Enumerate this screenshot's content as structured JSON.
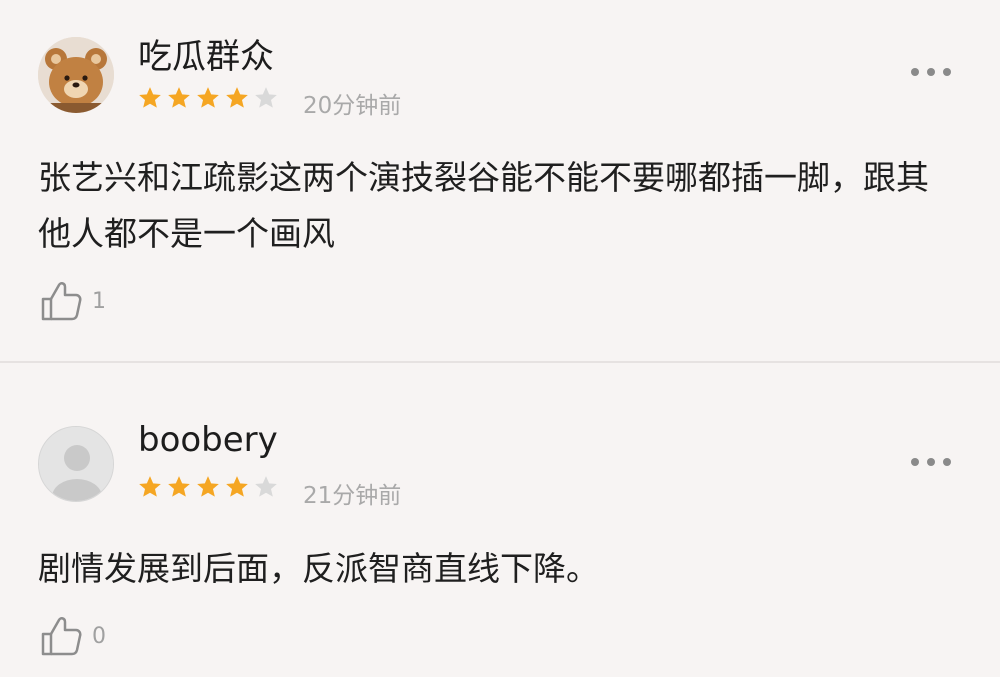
{
  "comments": [
    {
      "username": "吃瓜群众",
      "rating": 4,
      "rating_max": 5,
      "time": "20分钟前",
      "text": "张艺兴和江疏影这两个演技裂谷能不能不要哪都插一脚，跟其他人都不是一个画风",
      "likes": "1",
      "avatar": "bear-avatar"
    },
    {
      "username": "boobery",
      "rating": 4,
      "rating_max": 5,
      "time": "21分钟前",
      "text": "剧情发展到后面，反派智商直线下降。",
      "likes": "0",
      "avatar": "default-avatar"
    }
  ],
  "colors": {
    "star_filled": "#f5a623",
    "star_empty": "#d9d9d9",
    "divider": "#e6e2e1",
    "background": "#f7f4f3"
  },
  "icons": {
    "more": "more-dots-icon",
    "like": "thumbs-up-icon"
  }
}
